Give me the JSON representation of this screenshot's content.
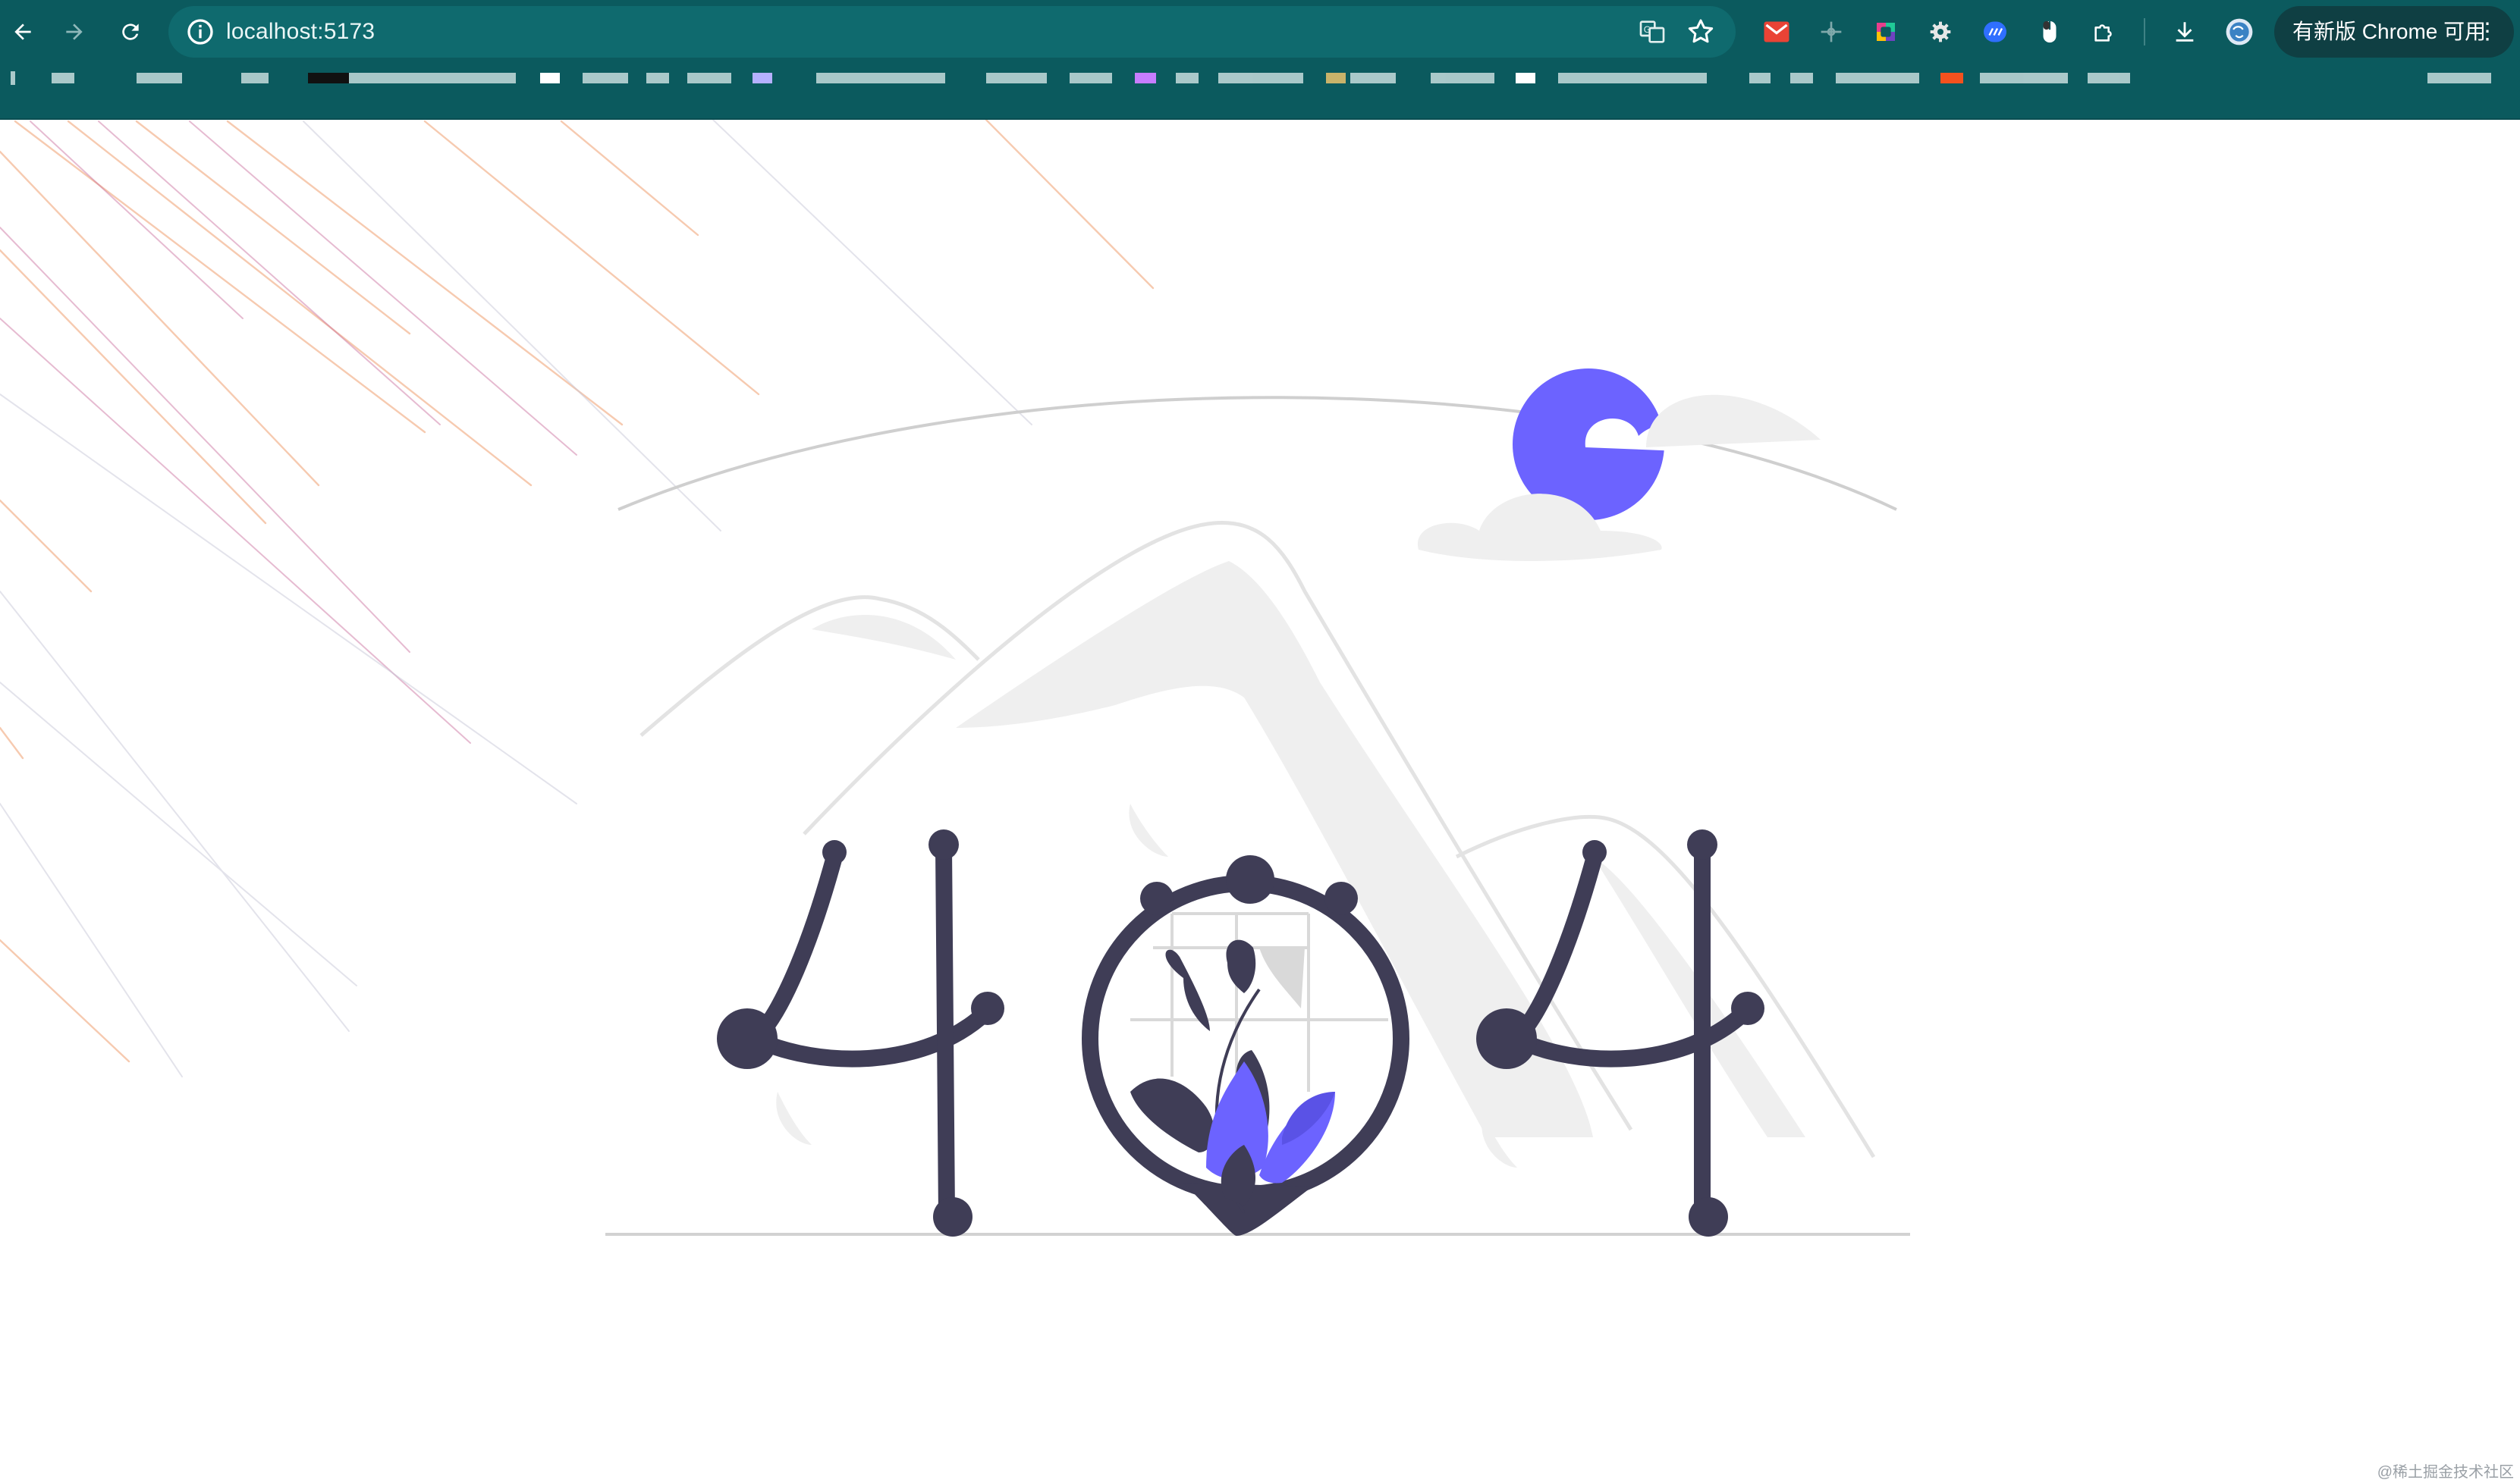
{
  "browser": {
    "url": "localhost:5173",
    "update_button_label": "有新版 Chrome 可用",
    "update_button_menu": "⋮",
    "nav_icons": [
      "back-icon",
      "forward-icon",
      "reload-icon"
    ],
    "omnibox_icons": [
      "site-info-icon",
      "translate-icon",
      "bookmark-star-icon"
    ],
    "extension_icons": [
      "gmail-extension-icon",
      "ruler-extension-icon",
      "color-picker-extension-icon",
      "gear-extension-icon",
      "blue-extension-icon",
      "mouse-extension-icon",
      "puzzle-extensions-icon",
      "download-icon",
      "profile-avatar-icon"
    ]
  },
  "page": {
    "illustration": "404",
    "accent_color": "#6c63ff",
    "ink_color": "#3f3d56",
    "watermark": "@稀土掘金技术社区"
  }
}
